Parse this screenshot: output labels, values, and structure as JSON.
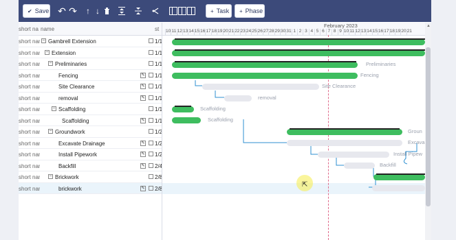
{
  "toolbar": {
    "save_label": "Save",
    "task_label": "Task",
    "phase_label": "Phase"
  },
  "grid": {
    "col_short": "short na",
    "col_name": "name",
    "col_start": "st",
    "rows": [
      {
        "short": "short nam",
        "name": "Gambrell Extension",
        "toggle": "−",
        "date": "1/1"
      },
      {
        "short": "short nam",
        "name": "Extension",
        "toggle": "−",
        "date": "1/1"
      },
      {
        "short": "short nam",
        "name": "Preliminaries",
        "toggle": "−",
        "date": "1/1"
      },
      {
        "short": "short nam",
        "name": "Fencing",
        "date": "1/1"
      },
      {
        "short": "short nam",
        "name": "Site Clearance",
        "date": "1/1"
      },
      {
        "short": "short nam",
        "name": "removal",
        "date": "1/1"
      },
      {
        "short": "short nam",
        "name": "Scaffolding",
        "toggle": "−",
        "date": "1/1"
      },
      {
        "short": "short nam",
        "name": "Scaffolding",
        "date": "1/1"
      },
      {
        "short": "short nam",
        "name": "Groundwork",
        "toggle": "−",
        "date": "1/2"
      },
      {
        "short": "short nam",
        "name": "Excavate Drainage",
        "date": "1/2"
      },
      {
        "short": "short nam",
        "name": "Install Pipework",
        "date": "1/2"
      },
      {
        "short": "short nam",
        "name": "Backfill",
        "date": "2/4"
      },
      {
        "short": "short nam",
        "name": "Brickwork",
        "toggle": "−",
        "date": "2/8"
      },
      {
        "short": "short nam",
        "name": "brickwork",
        "date": "2/8"
      }
    ]
  },
  "timeline": {
    "month": "February 2023",
    "days": [
      "10",
      "11",
      "12",
      "13",
      "14",
      "15",
      "16",
      "17",
      "18",
      "19",
      "20",
      "21",
      "22",
      "23",
      "24",
      "25",
      "26",
      "27",
      "28",
      "29",
      "30",
      "31",
      "1",
      "2",
      "3",
      "4",
      "5",
      "6",
      "7",
      "8",
      "9",
      "10",
      "11",
      "12",
      "13",
      "14",
      "15",
      "16",
      "17",
      "18",
      "19",
      "20",
      "21"
    ]
  },
  "bar_labels": {
    "preliminaries": "Preliminaries",
    "fencing": "Fencing",
    "site_clearance": "Site Clearance",
    "removal": "removal",
    "scaffolding": "Scaffolding",
    "scaffolding_task": "Scaffolding",
    "groundwork": "Groun",
    "excavate": "Excava",
    "pipework": "Install Pipew",
    "backfill": "Backfill"
  }
}
